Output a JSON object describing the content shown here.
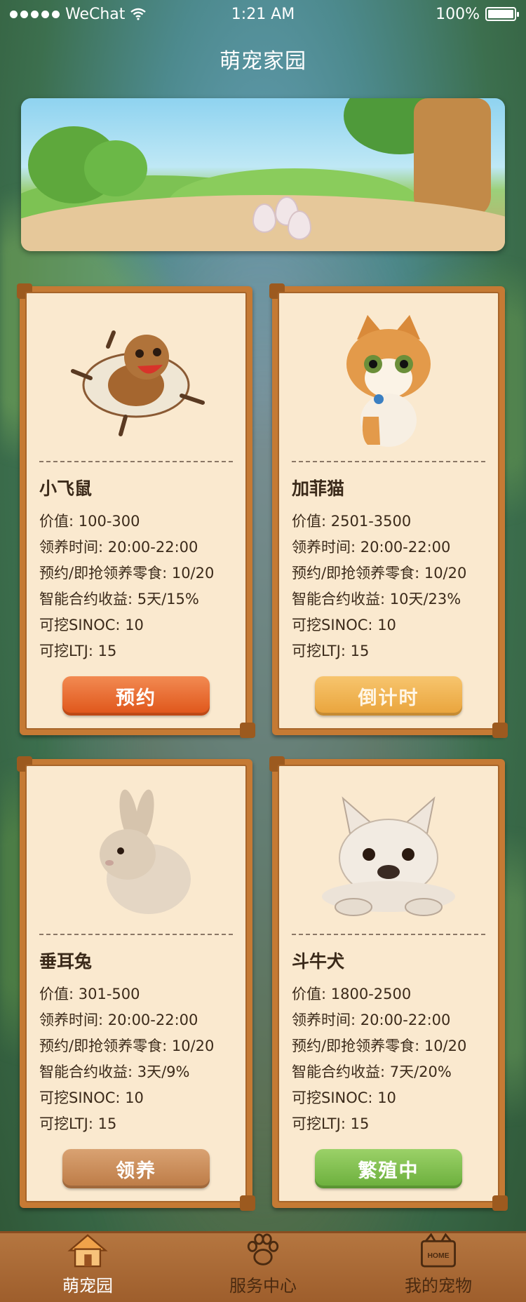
{
  "status_bar": {
    "carrier": "WeChat",
    "time": "1:21 AM",
    "battery": "100%"
  },
  "page_title": "萌宠家园",
  "banner": {
    "icon": "banner-scene-eggs"
  },
  "labels": {
    "value": "价值: ",
    "adopt_time": "领养时间: ",
    "snack": "预约/即抢领养零食: ",
    "contract": "智能合约收益: ",
    "sinoc": "可挖SINOC: ",
    "ltj": "可挖LTJ: "
  },
  "pets": [
    {
      "name": "小飞鼠",
      "value": "100-300",
      "adopt_time": "20:00-22:00",
      "snack": "10/20",
      "contract": "5天/15%",
      "sinoc": "10",
      "ltj": "15",
      "button": "预约",
      "icon": "flying-squirrel-image"
    },
    {
      "name": "加菲猫",
      "value": "2501-3500",
      "adopt_time": "20:00-22:00",
      "snack": "10/20",
      "contract": "10天/23%",
      "sinoc": "10",
      "ltj": "15",
      "button": "倒计时",
      "icon": "kitten-image"
    },
    {
      "name": "垂耳兔",
      "value": "301-500",
      "adopt_time": "20:00-22:00",
      "snack": "10/20",
      "contract": "3天/9%",
      "sinoc": "10",
      "ltj": "15",
      "button": "领养",
      "icon": "rabbit-image"
    },
    {
      "name": "斗牛犬",
      "value": "1800-2500",
      "adopt_time": "20:00-22:00",
      "snack": "10/20",
      "contract": "7天/20%",
      "sinoc": "10",
      "ltj": "15",
      "button": "繁殖中",
      "icon": "bulldog-image"
    }
  ],
  "tabs": [
    {
      "label": "萌宠园",
      "icon": "house-icon",
      "active": true
    },
    {
      "label": "服务中心",
      "icon": "paw-icon",
      "active": false
    },
    {
      "label": "我的宠物",
      "icon": "home-box-icon",
      "active": false,
      "icon_text": "HOME"
    }
  ],
  "colors": {
    "card_frame": "#c57a34",
    "card_bg": "#fae9cf",
    "btn_reserve": "#df5418",
    "btn_countdown": "#e9a33a",
    "btn_adopt": "#bc7a45",
    "btn_breeding": "#6aae3b",
    "tabbar": "#9e5e2c"
  }
}
